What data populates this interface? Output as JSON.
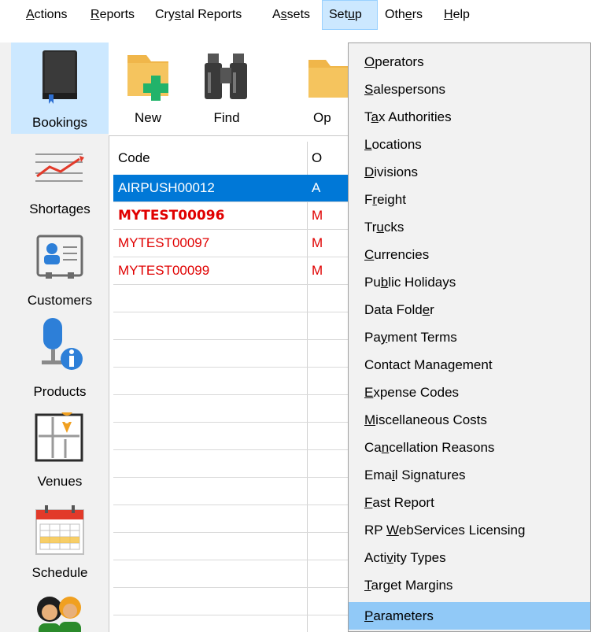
{
  "menubar": {
    "items": [
      {
        "pre": "",
        "ul": "A",
        "post": "ctions"
      },
      {
        "pre": "",
        "ul": "R",
        "post": "eports"
      },
      {
        "pre": "Cry",
        "ul": "s",
        "post": "tal Reports"
      },
      {
        "pre": "A",
        "ul": "s",
        "post": "sets"
      },
      {
        "pre": "Set",
        "ul": "u",
        "post": "p"
      },
      {
        "pre": "Oth",
        "ul": "e",
        "post": "rs"
      },
      {
        "pre": "",
        "ul": "H",
        "post": "elp"
      }
    ]
  },
  "sidebar": {
    "items": [
      {
        "label": "Bookings"
      },
      {
        "label": "Shortages"
      },
      {
        "label": "Customers"
      },
      {
        "label": "Products"
      },
      {
        "label": "Venues"
      },
      {
        "label": "Schedule"
      }
    ]
  },
  "toolbar": {
    "new_label": "New",
    "find_label": "Find",
    "open_label": "Op"
  },
  "grid": {
    "columns": [
      "Code",
      "O"
    ],
    "rows": [
      {
        "code": "AIRPUSH00012",
        "col2": "A"
      },
      {
        "code": "MYTEST00096",
        "col2": "M"
      },
      {
        "code": "MYTEST00097",
        "col2": "M"
      },
      {
        "code": "MYTEST00099",
        "col2": "M"
      }
    ]
  },
  "setup_menu": {
    "items": [
      {
        "pre": "",
        "ul": "O",
        "post": "perators"
      },
      {
        "pre": "",
        "ul": "S",
        "post": "alespersons"
      },
      {
        "pre": "T",
        "ul": "a",
        "post": "x Authorities"
      },
      {
        "pre": "",
        "ul": "L",
        "post": "ocations"
      },
      {
        "pre": "",
        "ul": "D",
        "post": "ivisions"
      },
      {
        "pre": "F",
        "ul": "r",
        "post": "eight"
      },
      {
        "pre": "Tr",
        "ul": "u",
        "post": "cks"
      },
      {
        "pre": "",
        "ul": "C",
        "post": "urrencies"
      },
      {
        "pre": "Pu",
        "ul": "b",
        "post": "lic Holidays"
      },
      {
        "pre": "Data Fold",
        "ul": "e",
        "post": "r"
      },
      {
        "pre": "Pa",
        "ul": "y",
        "post": "ment Terms"
      },
      {
        "pre": "Contact Mana",
        "ul": "g",
        "post": "ement"
      },
      {
        "pre": "",
        "ul": "E",
        "post": "xpense Codes"
      },
      {
        "pre": "",
        "ul": "M",
        "post": "iscellaneous Costs"
      },
      {
        "pre": "Ca",
        "ul": "n",
        "post": "cellation Reasons"
      },
      {
        "pre": "Ema",
        "ul": "i",
        "post": "l Signatures"
      },
      {
        "pre": "",
        "ul": "F",
        "post": "ast Report"
      },
      {
        "pre": "RP ",
        "ul": "W",
        "post": "ebServices Licensing"
      },
      {
        "pre": "Acti",
        "ul": "v",
        "post": "ity Types"
      },
      {
        "pre": "",
        "ul": "T",
        "post": "arget Margins"
      },
      {
        "pre": "",
        "ul": "P",
        "post": "arameters"
      }
    ]
  },
  "colors": {
    "selection": "#0078d7",
    "menu_highlight": "#91c9f7",
    "active_red": "#e00000",
    "sidebar_selected": "#cce8ff"
  }
}
